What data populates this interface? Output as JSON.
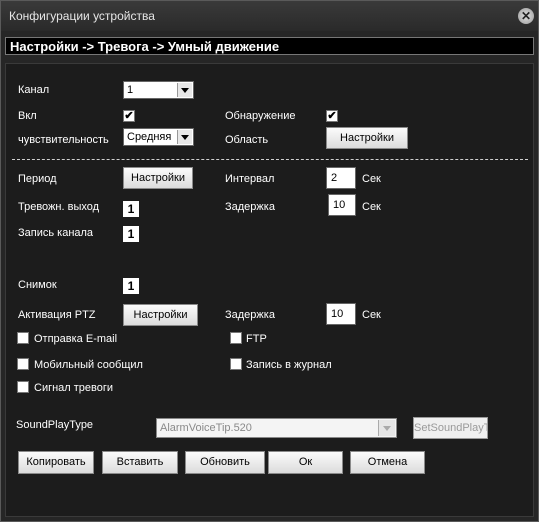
{
  "window": {
    "title": "Конфигурации устройства"
  },
  "breadcrumb": "Настройки -> Тревога -> Умный движение",
  "form": {
    "channel_label": "Канал",
    "channel_value": "1",
    "enable_label": "Вкл",
    "enable_checked": "✔",
    "detect_label": "Обнаружение",
    "detect_checked": "✔",
    "sensitivity_label": "чувствительность",
    "sensitivity_value": "Средняя",
    "area_label": "Область",
    "area_button": "Настройки",
    "period_label": "Период",
    "period_button": "Настройки",
    "interval_label": "Интервал",
    "interval_value": "2",
    "interval_unit": "Сек",
    "alarm_out_label": "Тревожн. выход",
    "alarm_out_value": "1",
    "delay_label": "Задержка",
    "delay_value": "10",
    "delay_unit": "Сек",
    "record_label": "Запись канала",
    "record_value": "1",
    "snapshot_label": "Снимок",
    "snapshot_value": "1",
    "ptz_label": "Активация PTZ",
    "ptz_button": "Настройки",
    "ptz_delay_label": "Задержка",
    "ptz_delay_value": "10",
    "ptz_delay_unit": "Сек",
    "email_label": "Отправка E-mail",
    "ftp_label": "FTP",
    "sms_label": "Мобильный сообщил",
    "log_label": "Запись в журнал",
    "alarm_signal_label": "Сигнал тревоги",
    "sound_label": "SoundPlayType",
    "sound_value": "AlarmVoiceTip.520",
    "sound_button": "SetSoundPlayType"
  },
  "footer": {
    "copy": "Копировать",
    "paste": "Вставить",
    "refresh": "Обновить",
    "ok": "Ок",
    "cancel": "Отмена"
  }
}
